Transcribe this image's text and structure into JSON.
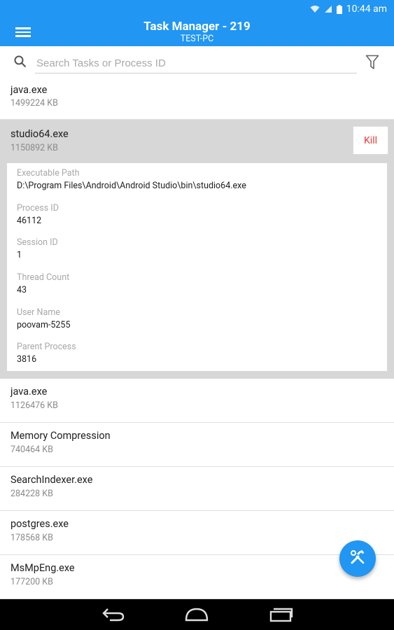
{
  "status_bar": {
    "time": "10:44 am"
  },
  "app_bar": {
    "title": "Task Manager - 219",
    "subtitle": "TEST-PC"
  },
  "search": {
    "placeholder": "Search Tasks or Process ID",
    "value": ""
  },
  "processes": [
    {
      "name": "java.exe",
      "memory": "1499224 KB"
    },
    {
      "name": "studio64.exe",
      "memory": "1150892 KB"
    },
    {
      "name": "java.exe",
      "memory": "1126476 KB"
    },
    {
      "name": "Memory Compression",
      "memory": "740464 KB"
    },
    {
      "name": "SearchIndexer.exe",
      "memory": "284228 KB"
    },
    {
      "name": "postgres.exe",
      "memory": "178568 KB"
    },
    {
      "name": "MsMpEng.exe",
      "memory": "177200 KB"
    }
  ],
  "expanded": {
    "kill_label": "Kill",
    "details": [
      {
        "label": "Executable Path",
        "value": "D:\\Program Files\\Android\\Android Studio\\bin\\studio64.exe"
      },
      {
        "label": "Process ID",
        "value": "46112"
      },
      {
        "label": "Session ID",
        "value": "1"
      },
      {
        "label": "Thread Count",
        "value": "43"
      },
      {
        "label": "User Name",
        "value": "poovam-5255"
      },
      {
        "label": "Parent Process",
        "value": "3816"
      }
    ]
  },
  "colors": {
    "primary": "#2196f3",
    "kill": "#e53935",
    "expanded_bg": "#d7d7d7"
  },
  "icons": [
    "wifi-icon",
    "signal-icon",
    "battery-icon",
    "menu-icon",
    "search-icon",
    "filter-icon",
    "tools-icon",
    "back-icon",
    "home-icon",
    "recents-icon"
  ]
}
